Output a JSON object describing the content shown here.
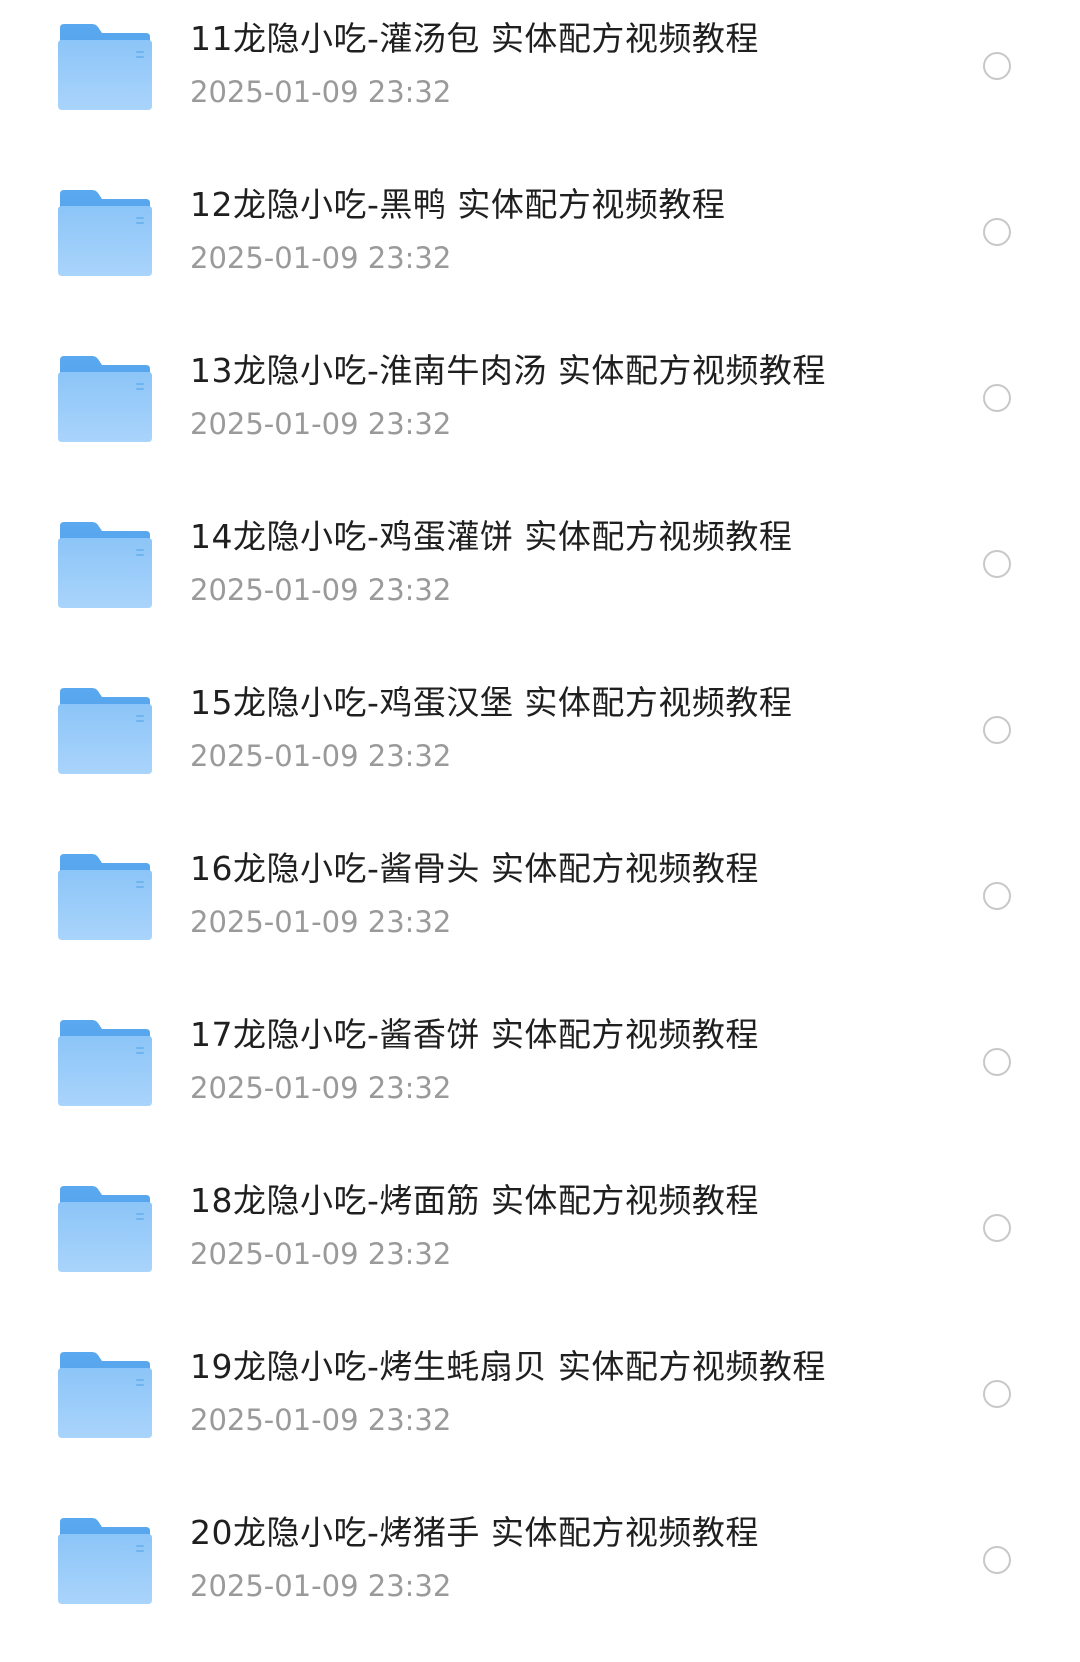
{
  "colors": {
    "folder_top": "#a9d4fb",
    "folder_bottom": "#64b0f2",
    "radio_border": "#c8c8c8",
    "name_text": "#1f1f1f",
    "date_text": "#9a9a9a"
  },
  "files": [
    {
      "name": "11龙隐小吃-灌汤包 实体配方视频教程",
      "date": "2025-01-09 23:32",
      "icon": "folder-icon"
    },
    {
      "name": "12龙隐小吃-黑鸭 实体配方视频教程",
      "date": "2025-01-09 23:32",
      "icon": "folder-icon"
    },
    {
      "name": "13龙隐小吃-淮南牛肉汤 实体配方视频教程",
      "date": "2025-01-09 23:32",
      "icon": "folder-icon"
    },
    {
      "name": "14龙隐小吃-鸡蛋灌饼 实体配方视频教程",
      "date": "2025-01-09 23:32",
      "icon": "folder-icon"
    },
    {
      "name": "15龙隐小吃-鸡蛋汉堡 实体配方视频教程",
      "date": "2025-01-09 23:32",
      "icon": "folder-icon"
    },
    {
      "name": "16龙隐小吃-酱骨头 实体配方视频教程",
      "date": "2025-01-09 23:32",
      "icon": "folder-icon"
    },
    {
      "name": "17龙隐小吃-酱香饼 实体配方视频教程",
      "date": "2025-01-09 23:32",
      "icon": "folder-icon"
    },
    {
      "name": "18龙隐小吃-烤面筋 实体配方视频教程",
      "date": "2025-01-09 23:32",
      "icon": "folder-icon"
    },
    {
      "name": "19龙隐小吃-烤生蚝扇贝 实体配方视频教程",
      "date": "2025-01-09 23:32",
      "icon": "folder-icon"
    },
    {
      "name": "20龙隐小吃-烤猪手 实体配方视频教程",
      "date": "2025-01-09 23:32",
      "icon": "folder-icon"
    }
  ]
}
